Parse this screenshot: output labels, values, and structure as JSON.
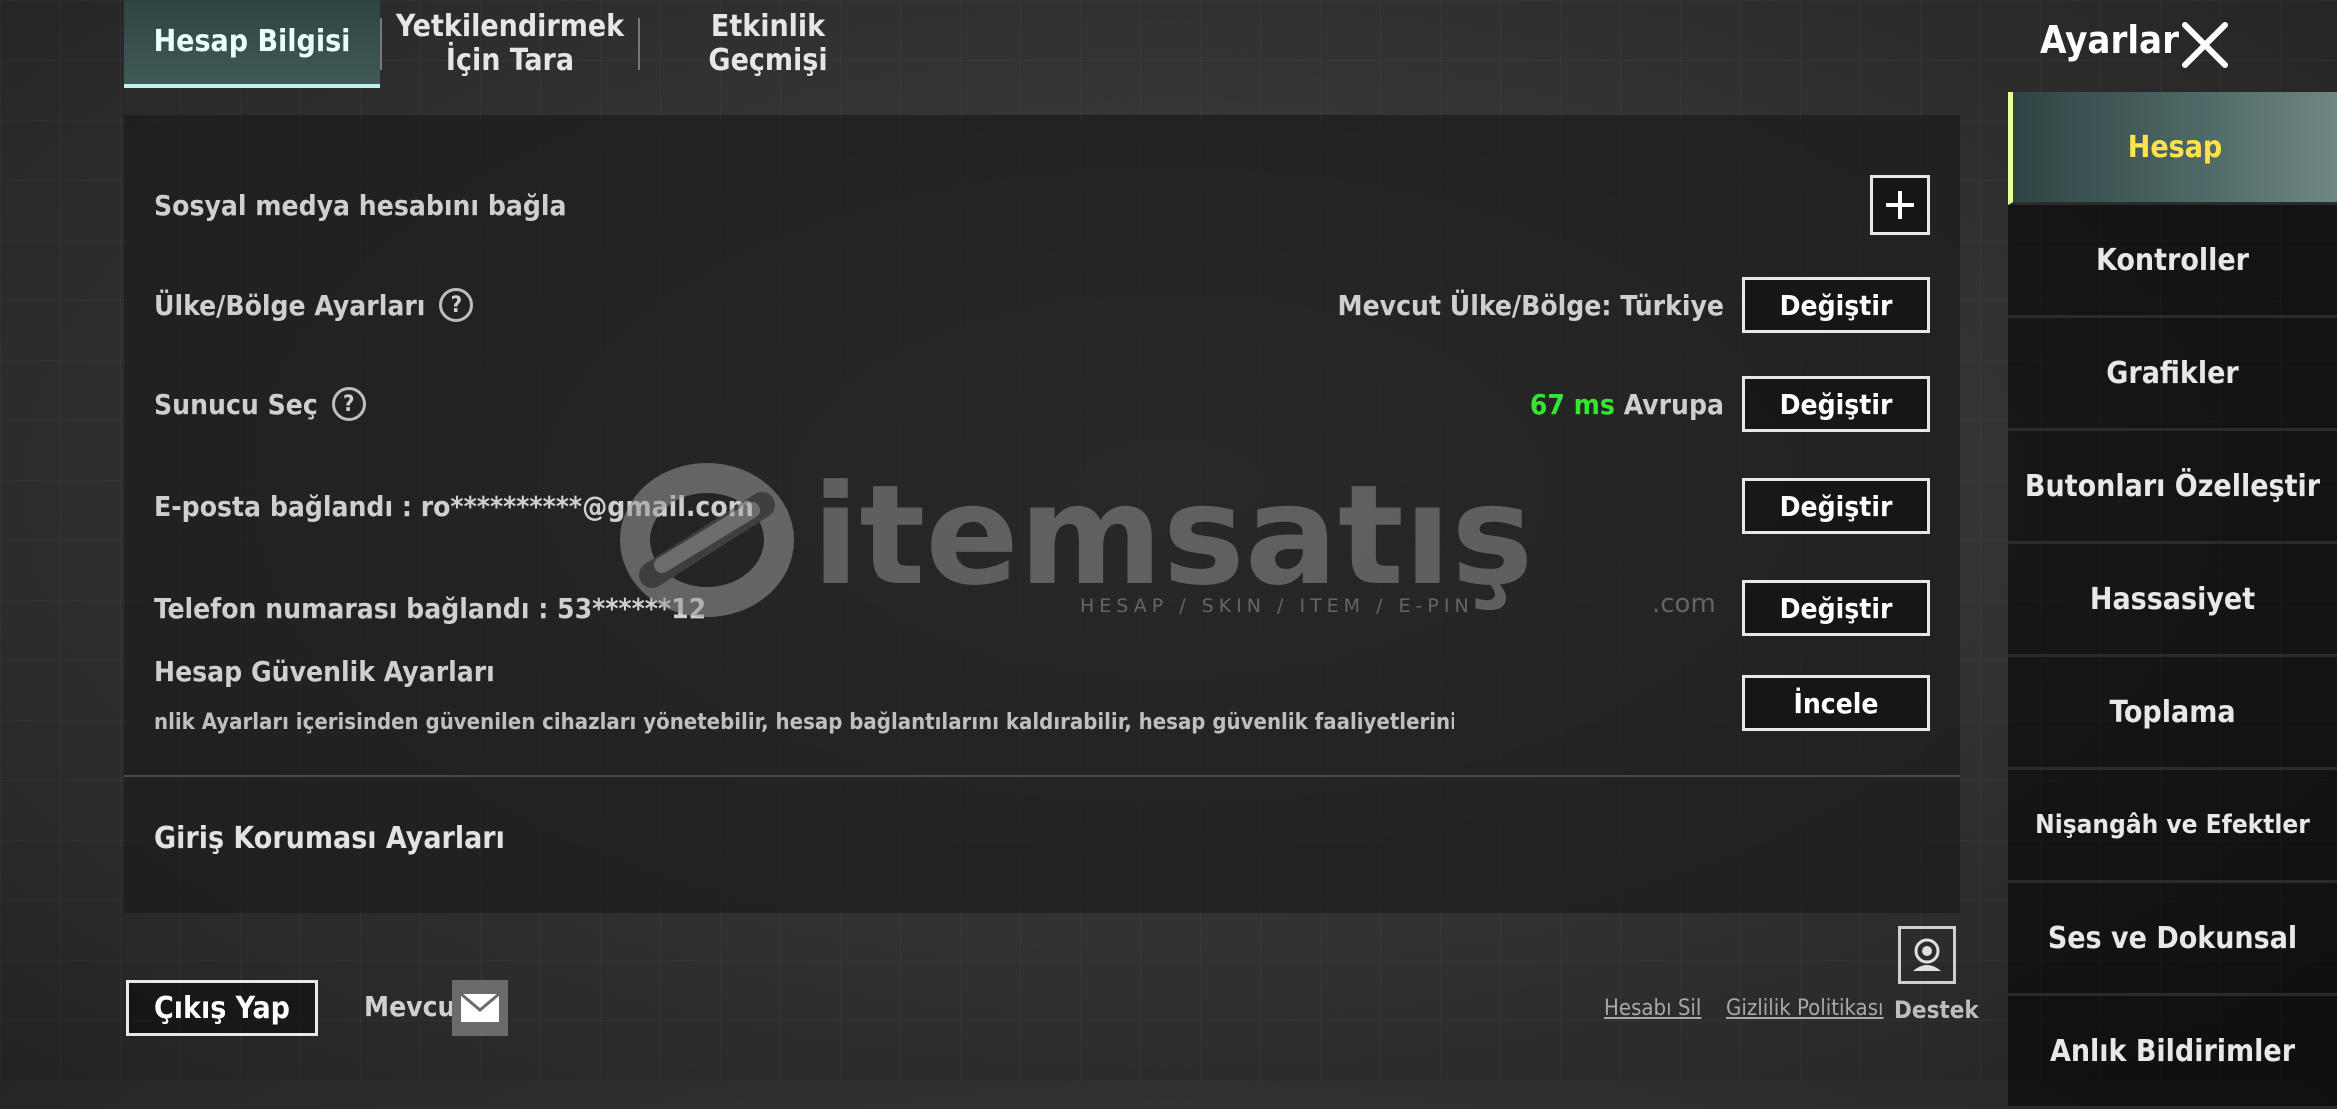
{
  "tabs": [
    {
      "label": "Hesap Bilgisi",
      "active": true
    },
    {
      "label": "Yetkilendirmek İçin Tara"
    },
    {
      "label": "Etkinlik Geçmişi"
    }
  ],
  "header": {
    "title": "Ayarlar"
  },
  "sidebar": {
    "items": [
      {
        "label": "Hesap",
        "active": true
      },
      {
        "label": "Kontroller"
      },
      {
        "label": "Grafikler"
      },
      {
        "label": "Butonları Özelleştir"
      },
      {
        "label": "Hassasiyet"
      },
      {
        "label": "Toplama"
      },
      {
        "label": "Nişangâh ve Efektler"
      },
      {
        "label": "Ses ve Dokunsal"
      },
      {
        "label": "Anlık Bildirimler"
      }
    ]
  },
  "account": {
    "social_label": "Sosyal medya hesabını bağla",
    "region_label": "Ülke/Bölge Ayarları",
    "region_value": "Mevcut Ülke/Bölge: Türkiye",
    "server_label": "Sunucu Seç",
    "server_ping": "67 ms",
    "server_region": "Avrupa",
    "email_label": "E-posta bağlandı : ro**********@gmail.com",
    "phone_label": "Telefon numarası bağlandı : 53******12",
    "security_title": "Hesap Güvenlik Ayarları",
    "security_desc": "nlik Ayarları içerisinden güvenilen cihazları yönetebilir, hesap bağlantılarını kaldırabilir, hesap güvenlik faaliyetlerini kontrol edebilir ve daha faz",
    "change_label": "Değiştir",
    "review_label": "İncele",
    "login_protection_title": "Giriş Koruması Ayarları"
  },
  "watermark": {
    "brand": "itemsatış",
    "tagline": "HESAP / SKIN / ITEM / E-PIN",
    "suffix": ".com"
  },
  "footer": {
    "logout_label": "Çıkış Yap",
    "current_label": "Mevcut",
    "delete_account": "Hesabı Sil",
    "privacy_policy": "Gizlilik Politikası",
    "support": "Destek"
  },
  "colors": {
    "ping": "#35e534",
    "active_sidebar_text": "#ffe34d",
    "accent": "#bff4ea"
  }
}
